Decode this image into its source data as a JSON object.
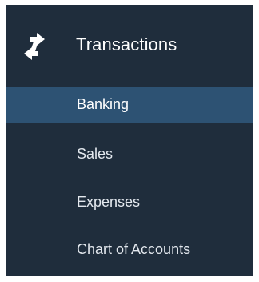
{
  "nav": {
    "section": {
      "title": "Transactions",
      "icon": "transactions-arrows-icon"
    },
    "items": [
      {
        "label": "Banking",
        "active": true
      },
      {
        "label": "Sales",
        "active": false
      },
      {
        "label": "Expenses",
        "active": false
      },
      {
        "label": "Chart of Accounts",
        "active": false
      }
    ]
  },
  "colors": {
    "panel_background": "#1f2d3c",
    "active_item_background": "#2d5273",
    "text": "#ffffff"
  }
}
